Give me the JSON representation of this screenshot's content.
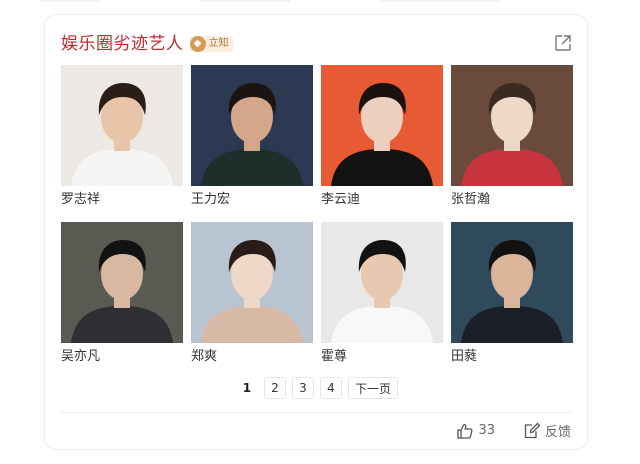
{
  "card": {
    "title": "娱乐圈劣迹艺人",
    "badge_label": "立知",
    "share_icon": "share-icon"
  },
  "people": [
    {
      "name": "罗志祥",
      "photo": {
        "bg": "#ece8e4",
        "shirt": "#f5f5f5",
        "hair": "#2a1d17",
        "skin": "#e8c4a8"
      }
    },
    {
      "name": "王力宏",
      "photo": {
        "bg": "#2b3a52",
        "shirt": "#1d2e2b",
        "hair": "#1c1412",
        "skin": "#d4a78a"
      }
    },
    {
      "name": "李云迪",
      "photo": {
        "bg": "#e85a33",
        "shirt": "#121212",
        "hair": "#1a1211",
        "skin": "#ecd0bd"
      }
    },
    {
      "name": "张哲瀚",
      "photo": {
        "bg": "#6a4a3a",
        "shirt": "#c8343e",
        "hair": "#3b2a22",
        "skin": "#eed8c8"
      }
    },
    {
      "name": "吴亦凡",
      "photo": {
        "bg": "#5a5a52",
        "shirt": "#2d2f33",
        "hair": "#121212",
        "skin": "#d8b8a0"
      }
    },
    {
      "name": "郑爽",
      "photo": {
        "bg": "#b8c4d0",
        "shirt": "#d8b9a6",
        "hair": "#2a1d18",
        "skin": "#f0d8c8"
      }
    },
    {
      "name": "霍尊",
      "photo": {
        "bg": "#e8e8e8",
        "shirt": "#f8f8f8",
        "hair": "#121212",
        "skin": "#e8c8b0"
      }
    },
    {
      "name": "田蕤",
      "photo": {
        "bg": "#2e4a5c",
        "shirt": "#1a1f2a",
        "hair": "#121212",
        "skin": "#dab59a"
      }
    }
  ],
  "pagination": {
    "pages": [
      "1",
      "2",
      "3",
      "4"
    ],
    "current": "1",
    "next_label": "下一页"
  },
  "footer": {
    "like_count": "33",
    "like_icon": "thumbs-up-icon",
    "feedback_label": "反馈",
    "feedback_icon": "edit-icon"
  },
  "colors": {
    "title": "#c0292c",
    "badge_bg": "#fbeee0",
    "badge_icon": "#d69b52"
  }
}
